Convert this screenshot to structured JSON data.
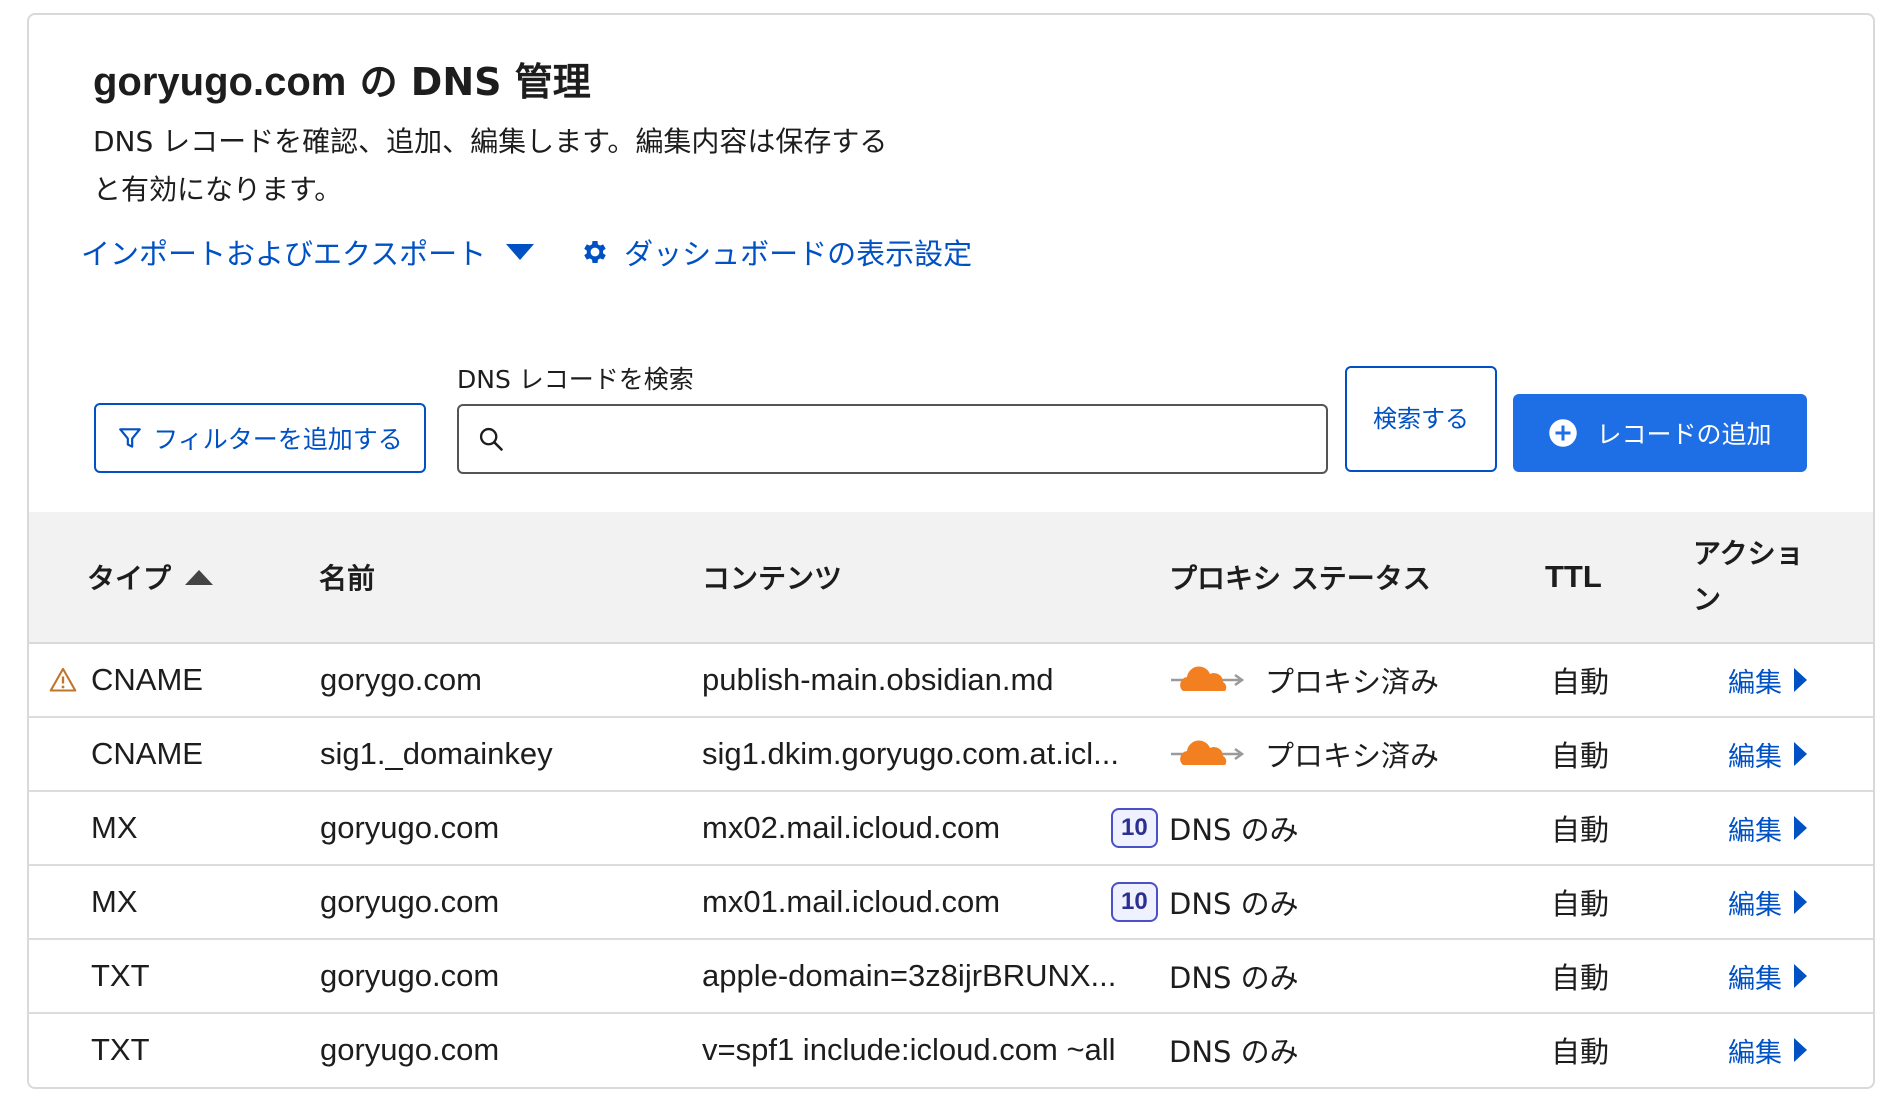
{
  "header": {
    "title_domain": "goryugo.com",
    "title_suffix": " の DNS 管理",
    "description": "DNS レコードを確認、追加、編集します。編集内容は保存すると有効になります。"
  },
  "links": {
    "import_export": "インポートおよびエクスポート",
    "dashboard_settings": "ダッシュボードの表示設定"
  },
  "search": {
    "label": "DNS レコードを検索",
    "value": "",
    "placeholder": "",
    "button": "検索する"
  },
  "filter_button": "フィルターを追加する",
  "add_record_button": "レコードの追加",
  "table": {
    "columns": {
      "type": "タイプ",
      "name": "名前",
      "content": "コンテンツ",
      "proxy": "プロキシ ステータス",
      "ttl": "TTL",
      "action": "アクション"
    },
    "rows": [
      {
        "type": "CNAME",
        "name": "gorygo.com",
        "content": "publish-main.obsidian.md",
        "priority": "",
        "proxy": "プロキシ済み",
        "ttl": "自動",
        "action": "編集",
        "warning": true,
        "proxied": true
      },
      {
        "type": "CNAME",
        "name": "sig1._domainkey",
        "content": "sig1.dkim.goryugo.com.at.icl...",
        "priority": "",
        "proxy": "プロキシ済み",
        "ttl": "自動",
        "action": "編集",
        "warning": false,
        "proxied": true
      },
      {
        "type": "MX",
        "name": "goryugo.com",
        "content": "mx02.mail.icloud.com",
        "priority": "10",
        "proxy": "DNS のみ",
        "ttl": "自動",
        "action": "編集",
        "warning": false,
        "proxied": false
      },
      {
        "type": "MX",
        "name": "goryugo.com",
        "content": "mx01.mail.icloud.com",
        "priority": "10",
        "proxy": "DNS のみ",
        "ttl": "自動",
        "action": "編集",
        "warning": false,
        "proxied": false
      },
      {
        "type": "TXT",
        "name": "goryugo.com",
        "content": "apple-domain=3z8ijrBRUNX...",
        "priority": "",
        "proxy": "DNS のみ",
        "ttl": "自動",
        "action": "編集",
        "warning": false,
        "proxied": false
      },
      {
        "type": "TXT",
        "name": "goryugo.com",
        "content": "v=spf1 include:icloud.com ~all",
        "priority": "",
        "proxy": "DNS のみ",
        "ttl": "自動",
        "action": "編集",
        "warning": false,
        "proxied": false
      }
    ]
  },
  "colors": {
    "link_blue": "#0051c3",
    "primary_button": "#1e6fe6",
    "cloud_orange": "#f38020",
    "warning": "#c0762a"
  },
  "icons": {
    "filter": "filter-icon",
    "search": "search-icon",
    "add": "plus-circle-icon",
    "gear": "gear-icon",
    "cloud": "cloud-proxy-icon",
    "warning": "warning-icon"
  }
}
